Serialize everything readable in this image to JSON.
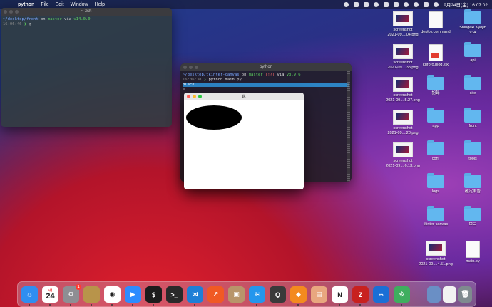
{
  "menubar": {
    "app_name": "python",
    "items": [
      "File",
      "Edit",
      "Window",
      "Help"
    ],
    "datetime": "9月24日(金)  16:07:02",
    "status_icons": [
      "record-icon",
      "camera-icon",
      "parking-icon",
      "cloud-icon",
      "dropbox-icon",
      "bluetooth-icon",
      "wifi-icon",
      "search-icon",
      "control-center-icon",
      "siri-icon"
    ]
  },
  "zsh_window": {
    "title": "~-zsh",
    "line1_path": "~/desktop/front",
    "line1_on": " on ",
    "line1_branch": "master",
    "line1_via": " via ",
    "line1_node": "v14.0.0",
    "line2_time": "16:06:46",
    "line2_prompt": " ❯ "
  },
  "python_window": {
    "title": "python",
    "line1_path": "~/desktop/tkinter-canvas",
    "line1_on": " on ",
    "line1_branch": "master",
    "line1_status": " [!?]",
    "line1_via": " via ",
    "line1_py": "v3.9.6",
    "line2_time": "16:06:38",
    "line2_prompt": " ❯ ",
    "line2_cmd": "python main.py",
    "line3_output": "black"
  },
  "tk_window": {
    "title": "tk",
    "oval_color": "#000000"
  },
  "desktop": {
    "icons": [
      {
        "label": "screenshot\n2021-09....04.png",
        "kind": "thumb"
      },
      {
        "label": "deploy.command",
        "kind": "doc"
      },
      {
        "label": "Shingeki Kyojin\nv34",
        "kind": "folder"
      },
      {
        "label": "screenshot\n2021-09....38.png",
        "kind": "thumb"
      },
      {
        "label": "kuroro.blog.stk",
        "kind": "docred"
      },
      {
        "label": "api",
        "kind": "folder"
      },
      {
        "label": "screenshot\n2021-09....5.27.png",
        "kind": "thumb"
      },
      {
        "label": "記録",
        "kind": "folder"
      },
      {
        "label": "site",
        "kind": "folder"
      },
      {
        "label": "screenshot\n2021-09....28.png",
        "kind": "thumb"
      },
      {
        "label": "app",
        "kind": "folder"
      },
      {
        "label": "front",
        "kind": "folder"
      },
      {
        "label": "screenshot\n2021-09....6.13.png",
        "kind": "thumb"
      },
      {
        "label": "conf",
        "kind": "folder"
      },
      {
        "label": "tools",
        "kind": "folder"
      },
      {
        "label": "logs",
        "kind": "folder"
      },
      {
        "label": "確定申告",
        "kind": "folder"
      },
      {
        "label": "tkinter-canvas",
        "kind": "folder"
      },
      {
        "label": "ロゴ",
        "kind": "folder"
      },
      {
        "label": "screenshot\n2021-09....4.51.png",
        "kind": "thumb"
      },
      {
        "label": "main.py",
        "kind": "doc"
      }
    ]
  },
  "dock": {
    "calendar_day": "24",
    "calendar_month": "9月",
    "settings_badge": "1",
    "apps": [
      {
        "name": "finder",
        "color": "#2f8ef0",
        "glyph": "☺"
      },
      {
        "name": "calendar",
        "color": "#ffffff",
        "glyph": ""
      },
      {
        "name": "system-preferences",
        "color": "#8e8e93",
        "glyph": "⚙"
      },
      {
        "name": "keychain",
        "color": "#b8944a",
        "glyph": ""
      },
      {
        "name": "chrome",
        "color": "#ffffff",
        "glyph": "◉"
      },
      {
        "name": "zoom",
        "color": "#2d8cff",
        "glyph": "▶"
      },
      {
        "name": "iterm",
        "color": "#1c1c1c",
        "glyph": "$"
      },
      {
        "name": "terminal",
        "color": "#2a2a2a",
        "glyph": ">_"
      },
      {
        "name": "vscode",
        "color": "#1e7fd6",
        "glyph": "⋊"
      },
      {
        "name": "activity",
        "color": "#f05a24",
        "glyph": "↗"
      },
      {
        "name": "archive-utility",
        "color": "#b8956a",
        "glyph": "▣"
      },
      {
        "name": "docker",
        "color": "#2496ed",
        "glyph": "≋"
      },
      {
        "name": "quicktime",
        "color": "#3a3a3a",
        "glyph": "Q"
      },
      {
        "name": "sourcetree",
        "color": "#f38a1f",
        "glyph": "◆"
      },
      {
        "name": "preview",
        "color": "#e8a77f",
        "glyph": "▤"
      },
      {
        "name": "notion",
        "color": "#ffffff",
        "glyph": "N"
      },
      {
        "name": "filezilla",
        "color": "#c8211f",
        "glyph": "Z"
      },
      {
        "name": "infinity",
        "color": "#1a6fd6",
        "glyph": "∞"
      },
      {
        "name": "xcode-like",
        "color": "#3fae5f",
        "glyph": "⟐"
      }
    ],
    "right_items": [
      {
        "name": "downloads-stack",
        "color": "#6a8fc5",
        "glyph": ""
      },
      {
        "name": "document-stack",
        "color": "#f2f2f2",
        "glyph": ""
      },
      {
        "name": "trash",
        "color": "#7f8a8f",
        "glyph": "🗑"
      }
    ]
  }
}
